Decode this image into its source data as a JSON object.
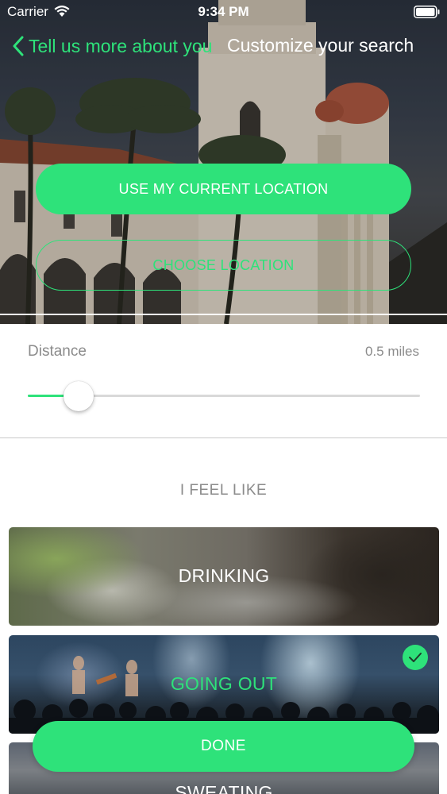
{
  "status_bar": {
    "carrier": "Carrier",
    "time": "9:34 PM",
    "icons": [
      "wifi-icon",
      "battery-icon"
    ]
  },
  "nav": {
    "back_label": "Tell us more about you",
    "title": "Customize your search",
    "back_icon": "chevron-left-icon"
  },
  "location": {
    "current_button": "USE MY CURRENT LOCATION",
    "choose_button": "CHOOSE LOCATION"
  },
  "distance": {
    "label": "Distance",
    "value": "0.5 miles",
    "slider_fraction": 0.13
  },
  "feel": {
    "title": "I FEEL LIKE",
    "options": [
      {
        "label": "DRINKING",
        "selected": false
      },
      {
        "label": "GOING OUT",
        "selected": true,
        "icon": "checkmark-icon"
      },
      {
        "label": "SWEATING",
        "selected": false
      }
    ]
  },
  "done_button": "DONE",
  "colors": {
    "accent": "#2ee27a",
    "muted_text": "#8b8b8b",
    "white": "#ffffff"
  }
}
